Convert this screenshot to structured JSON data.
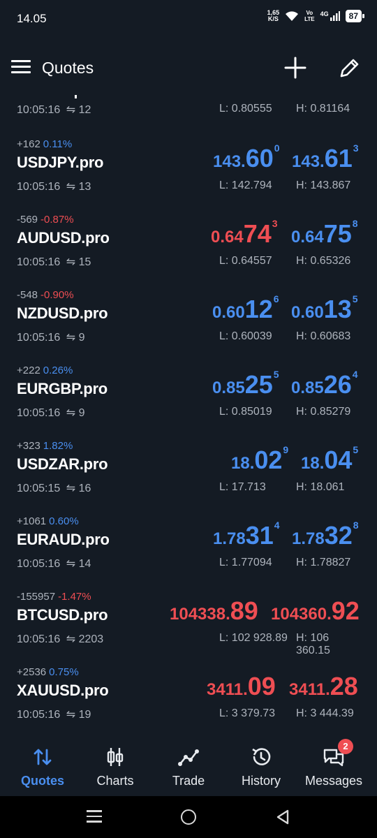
{
  "status_bar": {
    "time": "14.05",
    "net_speed_value": "1,65",
    "net_speed_unit": "K/S",
    "volte_line1": "Vo",
    "volte_line2": "LTE",
    "network": "4G",
    "battery": "87"
  },
  "appbar": {
    "title": "Quotes"
  },
  "partial_row": {
    "time": "10:05:16",
    "ticks": "12",
    "low": "L: 0.80555",
    "high": "H: 0.81164"
  },
  "rows": [
    {
      "change": "+162",
      "pct": "0.11%",
      "pct_color": "blue",
      "symbol": "USDJPY.pro",
      "bid": {
        "small": "143.",
        "big": "60",
        "sup": "0",
        "color": "blue"
      },
      "ask": {
        "small": "143.",
        "big": "61",
        "sup": "3",
        "color": "blue"
      },
      "time": "10:05:16",
      "ticks": "13",
      "low": "L: 142.794",
      "high": "H: 143.867"
    },
    {
      "change": "-569",
      "pct": "-0.87%",
      "pct_color": "red",
      "symbol": "AUDUSD.pro",
      "bid": {
        "small": "0.64",
        "big": "74",
        "sup": "3",
        "color": "red"
      },
      "ask": {
        "small": "0.64",
        "big": "75",
        "sup": "8",
        "color": "blue"
      },
      "time": "10:05:16",
      "ticks": "15",
      "low": "L: 0.64557",
      "high": "H: 0.65326"
    },
    {
      "change": "-548",
      "pct": "-0.90%",
      "pct_color": "red",
      "symbol": "NZDUSD.pro",
      "bid": {
        "small": "0.60",
        "big": "12",
        "sup": "6",
        "color": "blue"
      },
      "ask": {
        "small": "0.60",
        "big": "13",
        "sup": "5",
        "color": "blue"
      },
      "time": "10:05:16",
      "ticks": "9",
      "low": "L: 0.60039",
      "high": "H: 0.60683"
    },
    {
      "change": "+222",
      "pct": "0.26%",
      "pct_color": "blue",
      "symbol": "EURGBP.pro",
      "bid": {
        "small": "0.85",
        "big": "25",
        "sup": "5",
        "color": "blue"
      },
      "ask": {
        "small": "0.85",
        "big": "26",
        "sup": "4",
        "color": "blue"
      },
      "time": "10:05:16",
      "ticks": "9",
      "low": "L: 0.85019",
      "high": "H: 0.85279"
    },
    {
      "change": "+323",
      "pct": "1.82%",
      "pct_color": "blue",
      "symbol": "USDZAR.pro",
      "bid": {
        "small": "18.",
        "big": "02",
        "sup": "9",
        "color": "blue"
      },
      "ask": {
        "small": "18.",
        "big": "04",
        "sup": "5",
        "color": "blue"
      },
      "time": "10:05:15",
      "ticks": "16",
      "low": "L: 17.713",
      "high": "H: 18.061"
    },
    {
      "change": "+1061",
      "pct": "0.60%",
      "pct_color": "blue",
      "symbol": "EURAUD.pro",
      "bid": {
        "small": "1.78",
        "big": "31",
        "sup": "4",
        "color": "blue"
      },
      "ask": {
        "small": "1.78",
        "big": "32",
        "sup": "8",
        "color": "blue"
      },
      "time": "10:05:16",
      "ticks": "14",
      "low": "L: 1.77094",
      "high": "H: 1.78827"
    },
    {
      "change": "-155957",
      "pct": "-1.47%",
      "pct_color": "red",
      "symbol": "BTCUSD.pro",
      "bid": {
        "small": "104338.",
        "big": "89",
        "sup": "",
        "color": "red"
      },
      "ask": {
        "small": "104360.",
        "big": "92",
        "sup": "",
        "color": "red"
      },
      "time": "10:05:16",
      "ticks": "2203",
      "low": "L: 102 928.89",
      "high": "H: 106 360.15"
    },
    {
      "change": "+2536",
      "pct": "0.75%",
      "pct_color": "blue",
      "symbol": "XAUUSD.pro",
      "bid": {
        "small": "3411.",
        "big": "09",
        "sup": "",
        "color": "red"
      },
      "ask": {
        "small": "3411.",
        "big": "28",
        "sup": "",
        "color": "red"
      },
      "time": "10:05:16",
      "ticks": "19",
      "low": "L: 3 379.73",
      "high": "H: 3 444.39"
    }
  ],
  "bottom_nav": {
    "items": [
      {
        "label": "Quotes",
        "icon": "quotes-icon",
        "active": true
      },
      {
        "label": "Charts",
        "icon": "charts-icon",
        "active": false
      },
      {
        "label": "Trade",
        "icon": "trade-icon",
        "active": false
      },
      {
        "label": "History",
        "icon": "history-icon",
        "active": false
      },
      {
        "label": "Messages",
        "icon": "messages-icon",
        "active": false,
        "badge": "2"
      }
    ]
  },
  "colors": {
    "background": "#141b24",
    "blue": "#4a8ff0",
    "red": "#ef4e53",
    "muted": "#aeb4bd"
  }
}
